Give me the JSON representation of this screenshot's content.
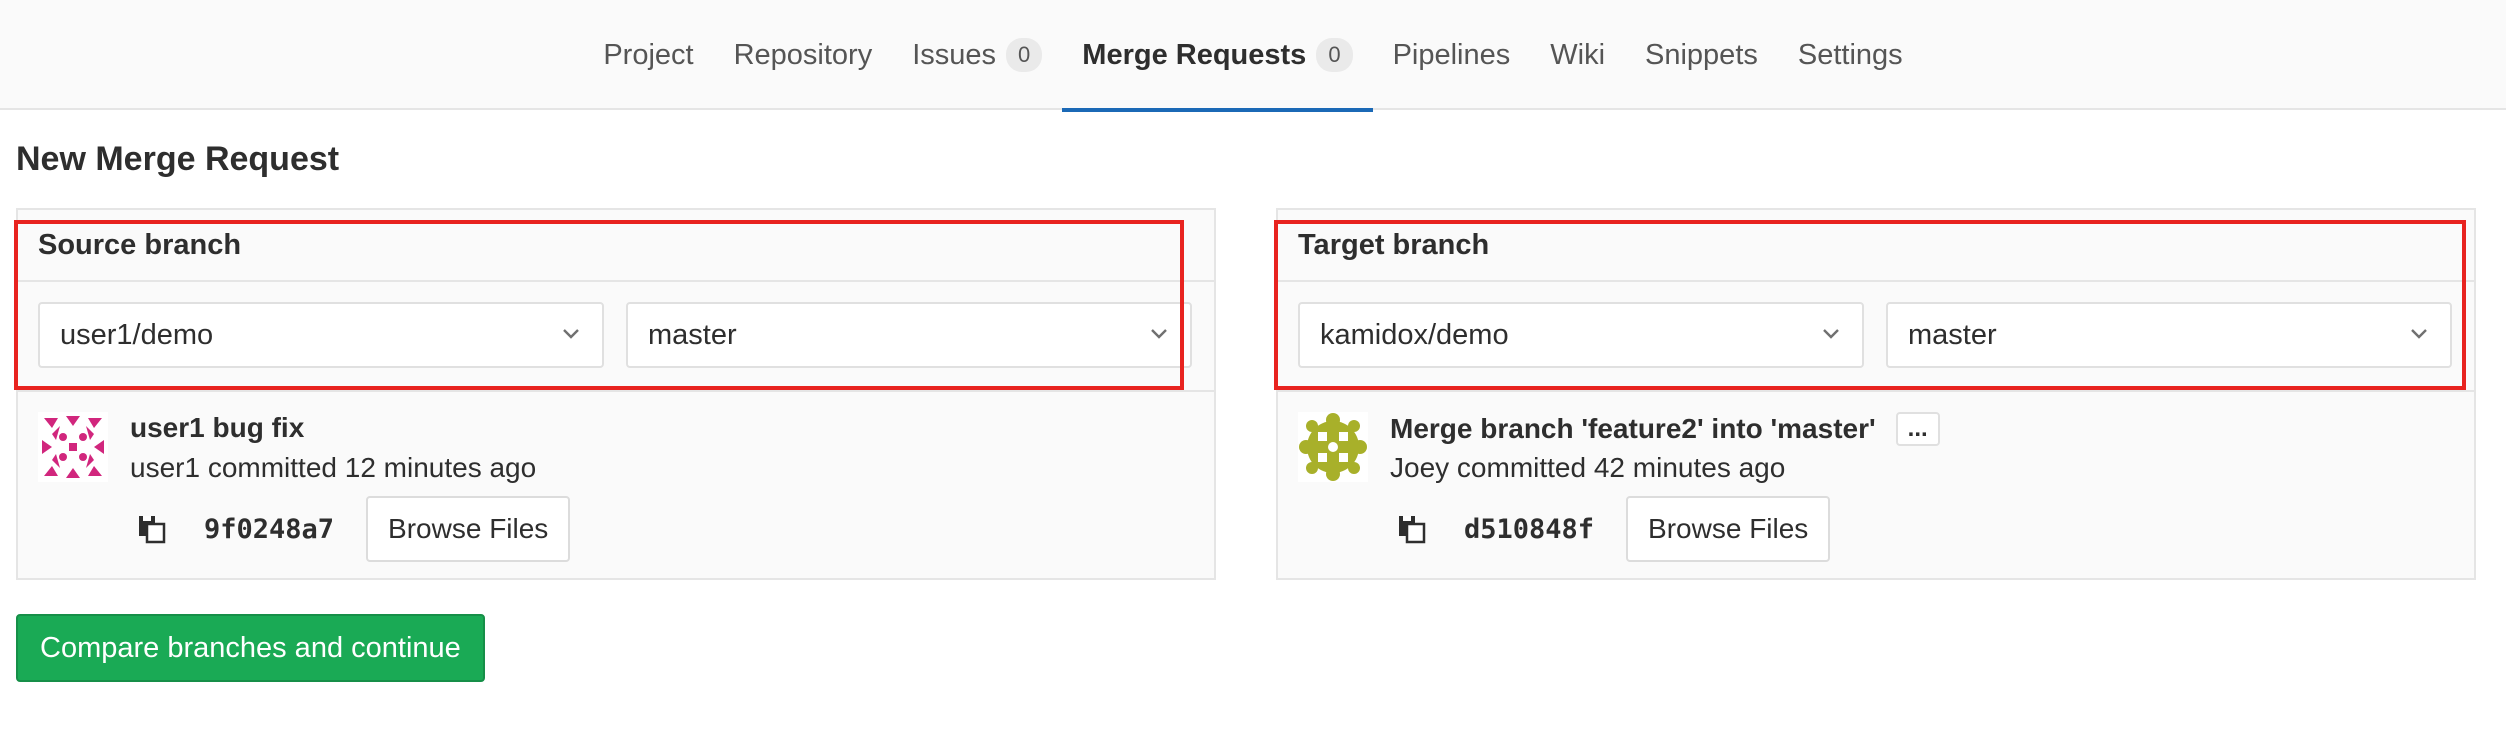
{
  "nav": {
    "items": [
      {
        "label": "Project"
      },
      {
        "label": "Repository"
      },
      {
        "label": "Issues",
        "badge": "0"
      },
      {
        "label": "Merge Requests",
        "badge": "0",
        "active": true
      },
      {
        "label": "Pipelines"
      },
      {
        "label": "Wiki"
      },
      {
        "label": "Snippets"
      },
      {
        "label": "Settings"
      }
    ],
    "active_color": "#1b69b6"
  },
  "page": {
    "title": "New Merge Request"
  },
  "source": {
    "header": "Source branch",
    "project": "user1/demo",
    "branch": "master",
    "commit": {
      "title": "user1 bug fix",
      "meta": "user1 committed 12 minutes ago",
      "sha": "9f0248a7",
      "browse_label": "Browse Files",
      "avatar_color": "#d1267d"
    }
  },
  "target": {
    "header": "Target branch",
    "project": "kamidox/demo",
    "branch": "master",
    "commit": {
      "title": "Merge branch 'feature2' into 'master'",
      "expand_label": "...",
      "meta": "Joey committed 42 minutes ago",
      "sha": "d510848f",
      "browse_label": "Browse Files",
      "avatar_color": "#a8b02a"
    }
  },
  "actions": {
    "compare_label": "Compare branches and continue",
    "compare_color": "#1aaa55"
  },
  "annotation": {
    "highlight_color": "#e8231f"
  }
}
